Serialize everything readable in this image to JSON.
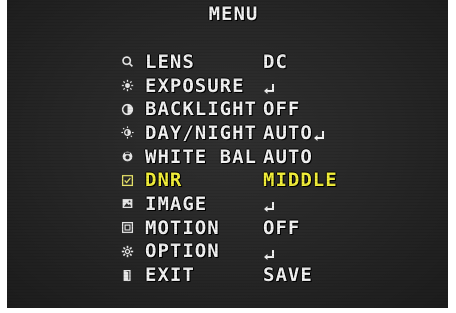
{
  "title": "MENU",
  "enter_symbol": "↲",
  "colors": {
    "text": "#f2f2f2",
    "selected": "#f2ef3a",
    "background": "#2a2a2a"
  },
  "items": [
    {
      "icon": "lens-icon",
      "label": "LENS",
      "value": "DC",
      "enter": false,
      "selected": false
    },
    {
      "icon": "exposure-sun-icon",
      "label": "EXPOSURE",
      "value": "",
      "enter": true,
      "selected": false
    },
    {
      "icon": "backlight-icon",
      "label": "BACKLIGHT",
      "value": "OFF",
      "enter": false,
      "selected": false
    },
    {
      "icon": "day-night-icon",
      "label": "DAY/NIGHT",
      "value": "AUTO",
      "enter": true,
      "selected": false
    },
    {
      "icon": "white-balance-icon",
      "label": "WHITE BAL",
      "value": "AUTO",
      "enter": false,
      "selected": false
    },
    {
      "icon": "dnr-icon",
      "label": "DNR",
      "value": "MIDDLE",
      "enter": false,
      "selected": true
    },
    {
      "icon": "image-icon",
      "label": "IMAGE",
      "value": "",
      "enter": true,
      "selected": false
    },
    {
      "icon": "motion-icon",
      "label": "MOTION",
      "value": "OFF",
      "enter": false,
      "selected": false
    },
    {
      "icon": "option-gear-icon",
      "label": "OPTION",
      "value": "",
      "enter": true,
      "selected": false
    },
    {
      "icon": "exit-door-icon",
      "label": "EXIT",
      "value": "SAVE",
      "enter": false,
      "selected": false
    }
  ]
}
